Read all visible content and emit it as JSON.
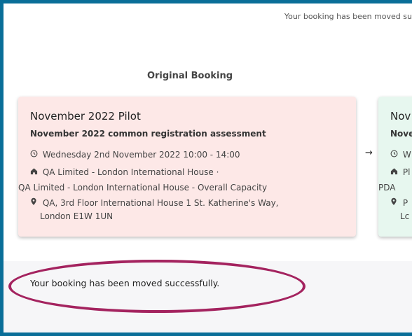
{
  "top_notice": "Your booking has been moved su",
  "original": {
    "section_title": "Original Booking",
    "title": "November 2022 Pilot",
    "subtitle": "November 2022 common registration assessment",
    "datetime": "Wednesday 2nd November 2022 10:00 - 14:00",
    "venue_line1": "QA Limited - London International House ·",
    "venue_line2": "QA Limited - London International House - Overall Capacity",
    "address_line1": "QA, 3rd Floor International House 1 St. Katherine's Way,",
    "address_line2": "London E1W 1UN"
  },
  "new": {
    "title": "Nov",
    "subtitle": "Nove",
    "datetime": "W",
    "venue_line1": "Pl",
    "venue_line2": "PDA",
    "address_line1": "P",
    "address_line2": "Lc"
  },
  "arrow": "→",
  "success_message": "Your booking has been moved successfully.",
  "colors": {
    "frame_border": "#0a6e98",
    "original_card_bg": "#fde8e7",
    "new_card_bg": "#e7f7ef",
    "highlight_ellipse": "#a4235f"
  },
  "icons": {
    "clock": "clock-icon",
    "home": "home-icon",
    "location": "location-pin-icon"
  }
}
